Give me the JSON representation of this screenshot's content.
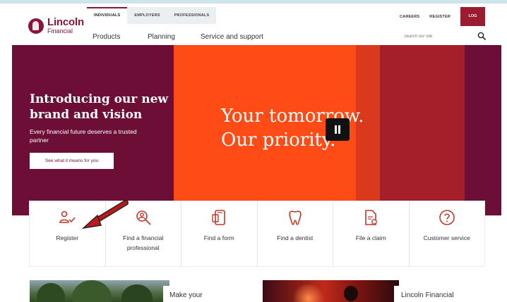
{
  "colors": {
    "brand": "#8a1538",
    "hero_plum": "#6d0e36",
    "hero_orange": "#ff4c16",
    "login_bg": "#9b1b30",
    "arrow": "#c01818"
  },
  "header": {
    "logo": {
      "line1": "Lincoln",
      "line2": "Financial",
      "icon": "lincoln-profile-icon"
    },
    "segment_tabs": [
      {
        "label": "INDIVIDUALS",
        "active": true
      },
      {
        "label": "EMPLOYERS",
        "active": false
      },
      {
        "label": "PROFESSIONALS",
        "active": false
      }
    ],
    "nav": {
      "products": "Products",
      "planning": "Planning",
      "service": "Service and support"
    },
    "util": {
      "careers": "CAREERS",
      "register": "REGISTER",
      "login": "LOG IN"
    },
    "search": {
      "placeholder": "Search our site",
      "icon": "search-icon"
    }
  },
  "hero": {
    "title": "Introducing our new brand and vision",
    "subtitle": "Every financial future deserves a trusted partner",
    "button": "See what it means for you",
    "tagline": "Your tomorrow. Our priority.",
    "pause_icon": "pause-icon"
  },
  "quick_links": [
    {
      "label": "Register",
      "icon": "user-check-icon"
    },
    {
      "label": "Find a financial professional",
      "icon": "search-person-icon"
    },
    {
      "label": "Find a form",
      "icon": "form-icon"
    },
    {
      "label": "Find a dentist",
      "icon": "tooth-icon"
    },
    {
      "label": "File a claim",
      "icon": "claim-document-icon"
    },
    {
      "label": "Customer service",
      "icon": "help-circle-icon"
    }
  ],
  "cards": [
    {
      "title": "Make your"
    },
    {
      "title": "Lincoln Financial"
    }
  ]
}
